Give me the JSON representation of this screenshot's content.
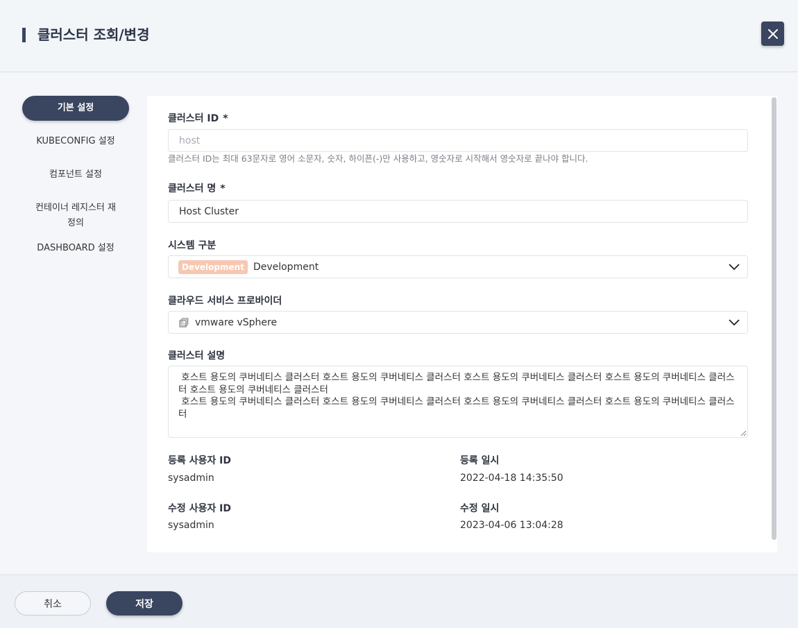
{
  "header": {
    "title": "클러스터 조회/변경"
  },
  "nav": {
    "items": [
      {
        "label": "기본 설정"
      },
      {
        "label": "KUBECONFIG 설정"
      },
      {
        "label": "컴포넌트 설정"
      },
      {
        "label": "컨테이너 레지스터 재\n정의"
      },
      {
        "label": "DASHBOARD 설정"
      }
    ]
  },
  "form": {
    "cluster_id": {
      "label": "클러스터 ID",
      "required_mark": "*",
      "placeholder": "host",
      "hint": "클러스터 ID는 최대 63문자로 영어 소문자, 숫자, 하이픈(-)만 사용하고, 영숫자로 시작해서 영숫자로 끝나야 합니다."
    },
    "cluster_name": {
      "label": "클러스터 명",
      "required_mark": "*",
      "value": "Host Cluster"
    },
    "system_type": {
      "label": "시스템 구분",
      "badge": "Development",
      "value": "Development"
    },
    "cloud_provider": {
      "label": "클라우드 서비스 프로바이더",
      "value": "vmware vSphere"
    },
    "description": {
      "label": "클러스터 설명",
      "value": " 호스트 용도의 쿠버네티스 클러스터 호스트 용도의 쿠버네티스 클러스터 호스트 용도의 쿠버네티스 클러스터 호스트 용도의 쿠버네티스 클러스터 호스트 용도의 쿠버네티스 클러스터\n 호스트 용도의 쿠버네티스 클러스터 호스트 용도의 쿠버네티스 클러스터 호스트 용도의 쿠버네티스 클러스터 호스트 용도의 쿠버네티스 클러스터"
    },
    "meta": {
      "created_by_label": "등록 사용자 ID",
      "created_by": "sysadmin",
      "created_at_label": "등록 일시",
      "created_at": "2022-04-18 14:35:50",
      "updated_by_label": "수정 사용자 ID",
      "updated_by": "sysadmin",
      "updated_at_label": "수정 일시",
      "updated_at": "2023-04-06 13:04:28"
    }
  },
  "footer": {
    "cancel_label": "취소",
    "save_label": "저장"
  },
  "colors": {
    "primary": "#3a4560",
    "badge": "#f7c7b2"
  },
  "icons": {
    "close": "close-icon",
    "chevron": "chevron-down-icon",
    "provider": "vsphere-icon"
  }
}
